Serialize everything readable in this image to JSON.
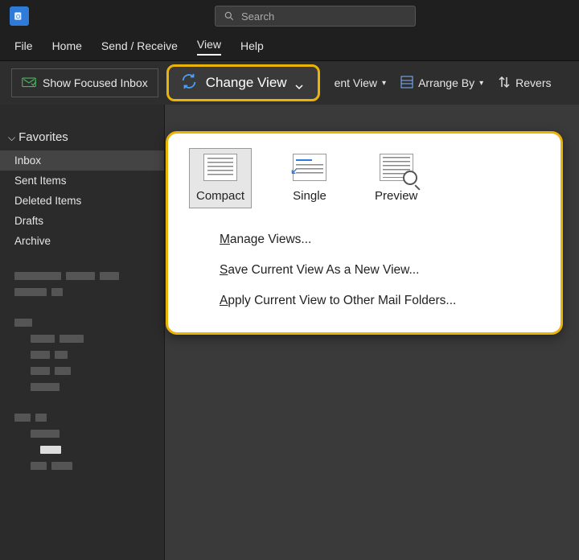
{
  "search": {
    "placeholder": "Search"
  },
  "menu": {
    "file": "File",
    "home": "Home",
    "sendreceive": "Send / Receive",
    "view": "View",
    "help": "Help"
  },
  "ribbon": {
    "focused": "Show Focused Inbox",
    "change_view": "Change View",
    "ent_view": "ent View",
    "arrange_by": "Arrange By",
    "reverse": "Revers"
  },
  "sidebar": {
    "favorites_label": "Favorites",
    "items": [
      "Inbox",
      "Sent Items",
      "Deleted Items",
      "Drafts",
      "Archive"
    ]
  },
  "dropdown": {
    "icons": [
      "Compact",
      "Single",
      "Preview"
    ],
    "items": [
      {
        "u": "M",
        "rest": "anage Views..."
      },
      {
        "u": "S",
        "rest": "ave Current View As a New View..."
      },
      {
        "u": "A",
        "rest": "pply Current View to Other Mail Folders..."
      }
    ]
  }
}
